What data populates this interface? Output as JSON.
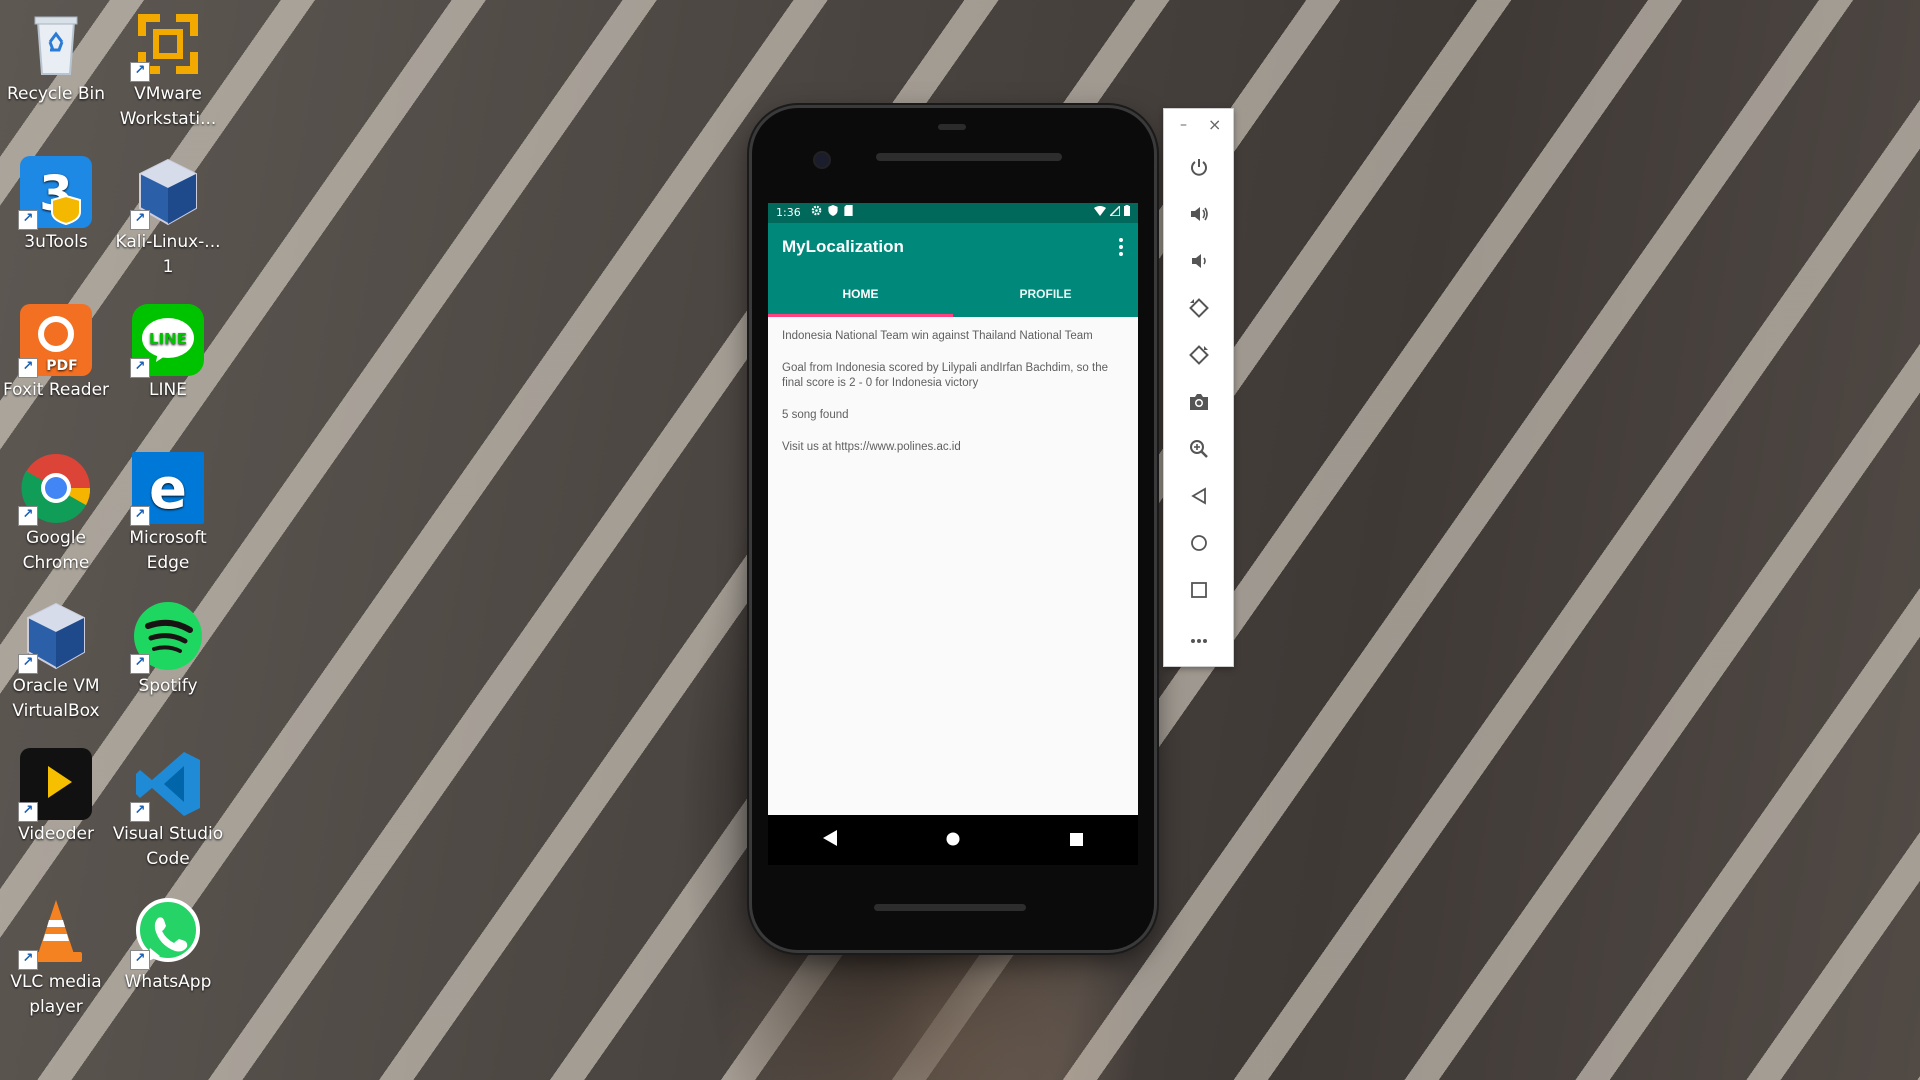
{
  "desktop": {
    "icons": [
      {
        "name": "recycle-bin-icon",
        "label": "Recycle Bin"
      },
      {
        "name": "vmware-workstation-icon",
        "label": "VMware Workstati..."
      },
      {
        "name": "3utools-icon",
        "label": "3uTools"
      },
      {
        "name": "kali-linux-icon",
        "label": "Kali-Linux-... 1"
      },
      {
        "name": "foxit-reader-icon",
        "label": "Foxit Reader"
      },
      {
        "name": "line-icon",
        "label": "LINE"
      },
      {
        "name": "google-chrome-icon",
        "label": "Google Chrome"
      },
      {
        "name": "microsoft-edge-icon",
        "label": "Microsoft Edge"
      },
      {
        "name": "oracle-virtualbox-icon",
        "label": "Oracle VM VirtualBox"
      },
      {
        "name": "spotify-icon",
        "label": "Spotify"
      },
      {
        "name": "videoder-icon",
        "label": "Videoder"
      },
      {
        "name": "vscode-icon",
        "label": "Visual Studio Code"
      },
      {
        "name": "vlc-icon",
        "label": "VLC media player"
      },
      {
        "name": "whatsapp-icon",
        "label": "WhatsApp"
      }
    ]
  },
  "phone": {
    "status_bar": {
      "time": "1:36"
    },
    "app_bar": {
      "title": "MyLocalization"
    },
    "tabs": [
      {
        "label": "HOME",
        "active": true
      },
      {
        "label": "PROFILE",
        "active": false
      }
    ],
    "content": [
      "Indonesia National Team win against Thailand National Team",
      "Goal from Indonesia scored by Lilypali andIrfan Bachdim, so the final score is 2 - 0 for Indonesia victory",
      "5 song found",
      "Visit us at https://www.polines.ac.id"
    ]
  },
  "emulator_toolbar": {
    "minimize": "–",
    "close": "×",
    "buttons": [
      "power-icon",
      "volume-up-icon",
      "volume-down-icon",
      "rotate-left-icon",
      "rotate-right-icon",
      "camera-icon",
      "zoom-icon",
      "back-icon",
      "home-icon",
      "overview-icon",
      "more-icon"
    ]
  },
  "colors": {
    "primary": "#00897b",
    "primary_dark": "#00695c",
    "accent": "#ff4081"
  }
}
